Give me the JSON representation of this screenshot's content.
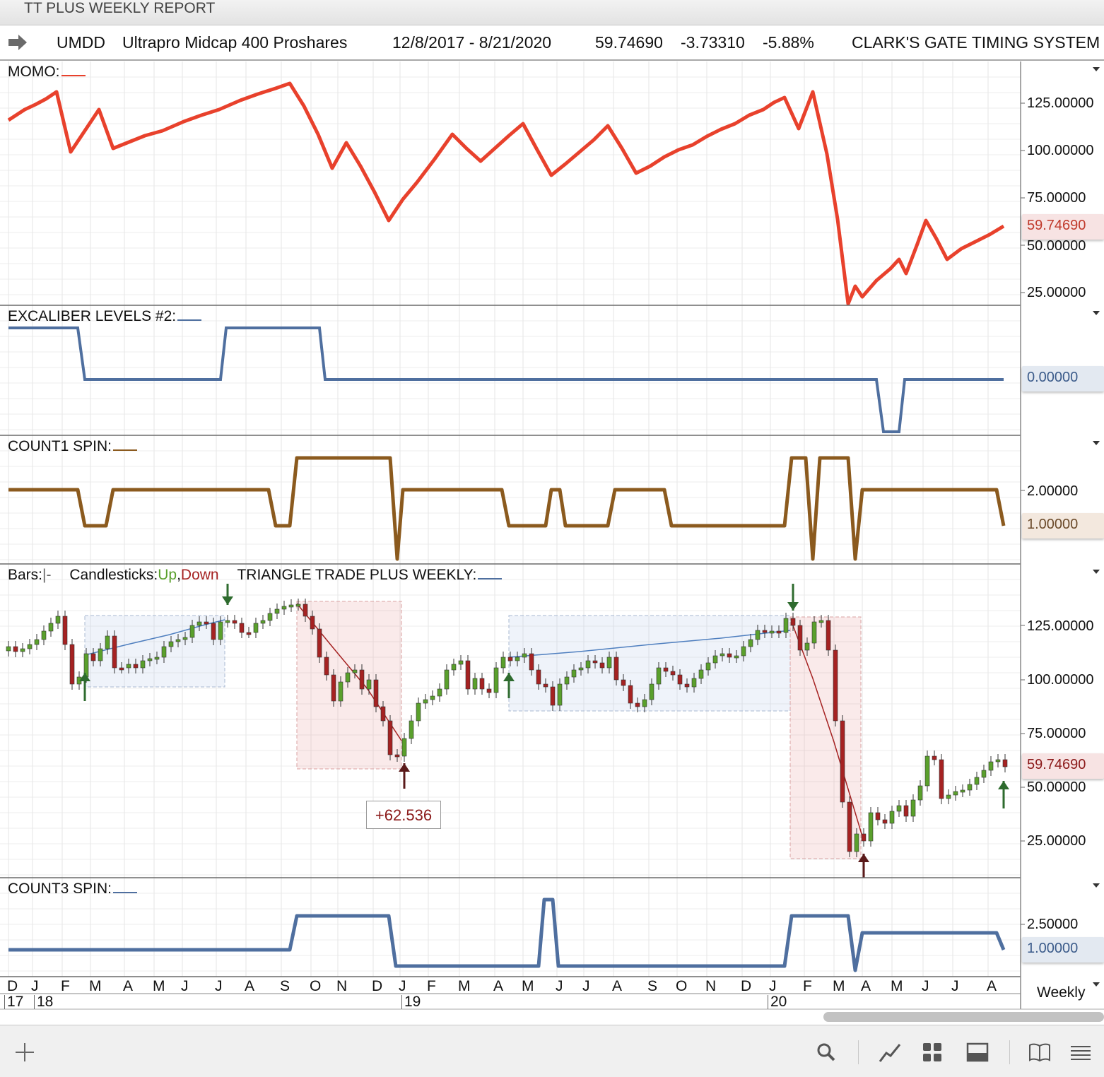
{
  "window": {
    "title": "TT PLUS WEEKLY REPORT"
  },
  "header": {
    "symbol": "UMDD",
    "name": "Ultrapro Midcap 400 Proshares",
    "date_range": "12/8/2017 - 8/21/2020",
    "last": "59.74690",
    "change": "-3.73310",
    "change_pct": "-5.88%",
    "system": "CLARK'S GATE TIMING SYSTEM"
  },
  "panels": {
    "momo": {
      "label": "MOMO:",
      "color": "#e8412c",
      "axis": [
        "125.00000",
        "100.00000",
        "75.00000",
        "50.00000",
        "25.00000"
      ],
      "last_tag": "59.74690"
    },
    "excaliber": {
      "label": "EXCALIBER LEVELS #2:",
      "color": "#4f6f9f",
      "last_tag": "0.00000"
    },
    "count1": {
      "label": "COUNT1 SPIN:",
      "color": "#8b5a1e",
      "axis": [
        "2.00000"
      ],
      "last_tag": "1.00000"
    },
    "price": {
      "label_bars": "Bars:",
      "label_bars_icon": "|-",
      "label_candles": "Candlesticks:",
      "label_up": "Up",
      "label_sep": ",",
      "label_down": "Down",
      "label_study": "TRIANGLE TRADE PLUS WEEKLY:",
      "up_color": "#5aa02c",
      "down_color": "#a52222",
      "axis": [
        "125.00000",
        "100.00000",
        "75.00000",
        "50.00000",
        "25.00000"
      ],
      "last_tag": "59.74690",
      "trade_result": "+62.536"
    },
    "count3": {
      "label": "COUNT3 SPIN:",
      "color": "#4f6f9f",
      "axis": [
        "2.50000"
      ],
      "last_tag": "1.00000"
    }
  },
  "time_axis": {
    "months": [
      "D",
      "J",
      "F",
      "M",
      "A",
      "M",
      "J",
      "J",
      "A",
      "S",
      "O",
      "N",
      "D",
      "J",
      "F",
      "M",
      "A",
      "M",
      "J",
      "J",
      "A",
      "S",
      "O",
      "N",
      "D",
      "J",
      "F",
      "M",
      "A",
      "M",
      "J",
      "J",
      "A"
    ],
    "years": [
      "17",
      "18",
      "19",
      "20"
    ]
  },
  "frequency": "Weekly",
  "toolbar": {
    "add": "plus-icon",
    "search": "search-icon",
    "draw": "draw-trend-icon",
    "layout": "grid-layout-icon",
    "panel": "panel-icon",
    "book": "book-icon",
    "menu": "menu-icon"
  }
}
